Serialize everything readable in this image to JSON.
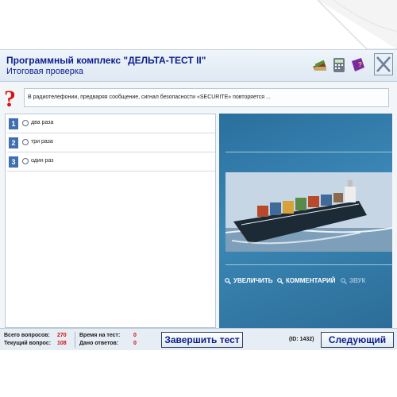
{
  "header": {
    "title": "Программный комплекс \"ДЕЛЬТА-ТЕСТ II\"",
    "subtitle": "Итоговая проверка"
  },
  "toolbar": {
    "icons": [
      "books-icon",
      "calculator-icon",
      "book-icon",
      "close-icon"
    ]
  },
  "question": {
    "text": "В радиотелефонии, предваряя сообщение, сигнал безопасности «SECURITE» повторяется ..."
  },
  "answers": [
    {
      "num": "1",
      "text": "два раза"
    },
    {
      "num": "2",
      "text": "три раза"
    },
    {
      "num": "3",
      "text": "один раз"
    }
  ],
  "media": {
    "buttons": {
      "zoom": "УВЕЛИЧИТЬ",
      "comment": "КОММЕНТАРИЙ",
      "sound": "ЗВУК"
    }
  },
  "status": {
    "total_label": "Всего вопросов:",
    "total_value": "270",
    "current_label": "Текущий вопрос:",
    "current_value": "108",
    "time_label": "Время на тест:",
    "time_value": "0",
    "given_label": "Дано ответов:",
    "given_value": "0",
    "finish_label": "Завершить тест",
    "id_text": "(ID: 1432)",
    "next_label": "Следующий"
  },
  "colors": {
    "title": "#0a1e8c",
    "status_value": "#d01010",
    "media_bg": "#3b87b5",
    "number_badge": "#3f6fb0"
  }
}
